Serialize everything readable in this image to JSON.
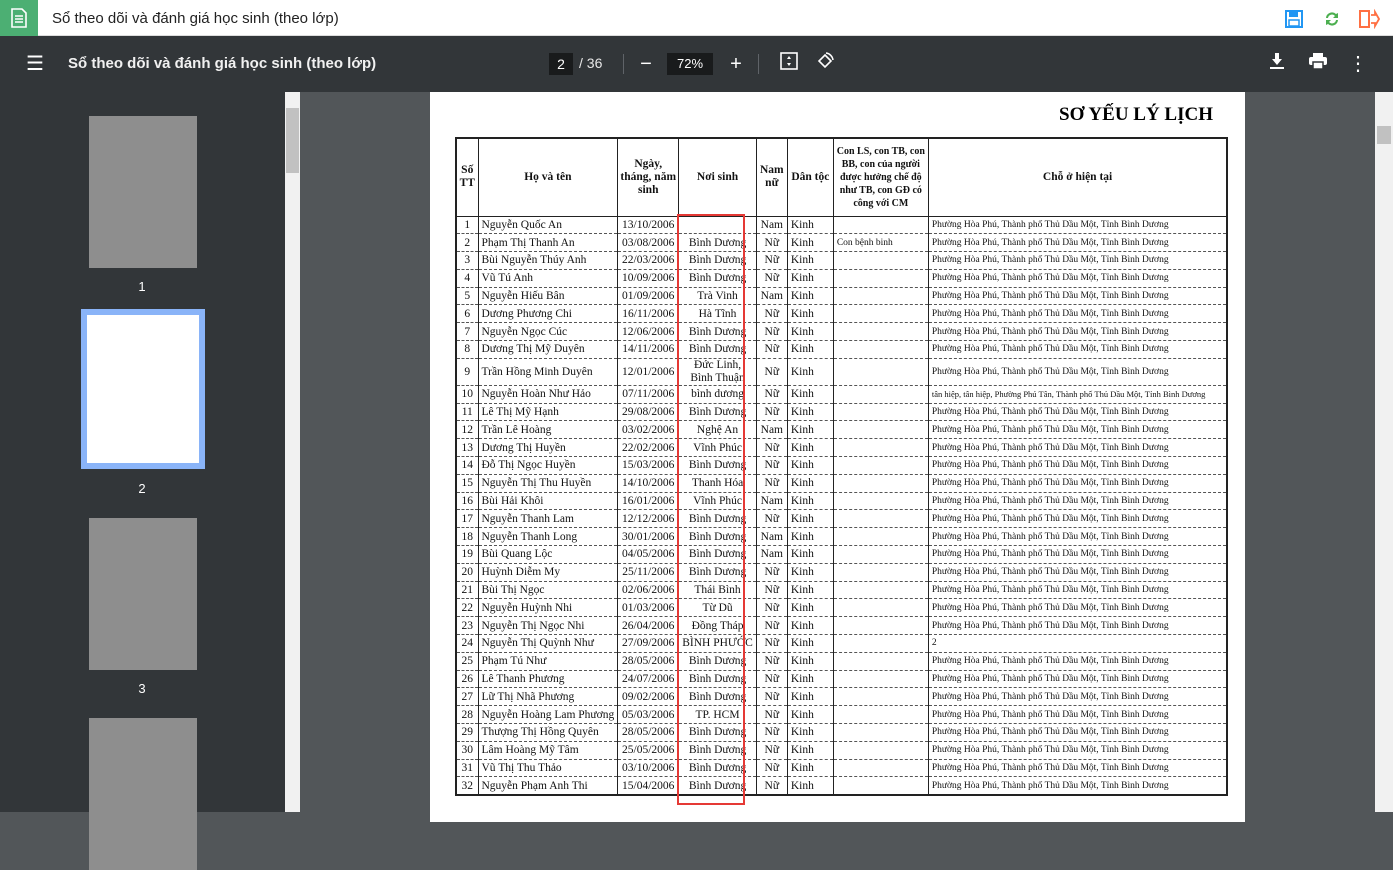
{
  "app": {
    "title": "Sổ theo dõi và đánh giá học sinh (theo lớp)",
    "colors": {
      "accent": "#4caf73",
      "save": "#2196f3",
      "sync": "#4caf50",
      "exit": "#ff7043",
      "highlight": "#e53935"
    }
  },
  "toolbar": {
    "title": "Sổ theo dõi và đánh giá học sinh (theo lớp)",
    "page": "2",
    "total": "/ 36",
    "zoom": "72%",
    "icons": [
      "menu-icon",
      "zoom-out-icon",
      "zoom-in-icon",
      "fit-page-icon",
      "rotate-icon",
      "download-icon",
      "print-icon",
      "more-icon"
    ]
  },
  "thumbs": [
    "1",
    "2",
    "3"
  ],
  "doc": {
    "title": "SƠ YẾU LÝ LỊCH",
    "headers": [
      "Số TT",
      "Họ và tên",
      "Ngày, tháng, năm sinh",
      "Nơi sinh",
      "Nam nữ",
      "Dân tộc",
      "Con LS, con TB, con BB, con của người được hưởng chế độ như TB, con GĐ có công với CM",
      "Chỗ ở hiện tại"
    ],
    "rows": [
      [
        "1",
        "Nguyễn Quốc An",
        "13/10/2006",
        "",
        "Nam",
        "Kinh",
        "",
        "Phường Hòa Phú, Thành phố Thủ Dầu Một, Tỉnh Bình Dương"
      ],
      [
        "2",
        "Phạm Thị Thanh An",
        "03/08/2006",
        "Bình Dương",
        "Nữ",
        "Kinh",
        "Con bệnh binh",
        "Phường Hòa Phú, Thành phố Thủ Dầu Một, Tỉnh Bình Dương"
      ],
      [
        "3",
        "Bùi Nguyễn Thúy Anh",
        "22/03/2006",
        "Bình Dương",
        "Nữ",
        "Kinh",
        "",
        "Phường Hòa Phú, Thành phố Thủ Dầu Một, Tỉnh Bình Dương"
      ],
      [
        "4",
        "Vũ Tú Anh",
        "10/09/2006",
        "Bình Dương",
        "Nữ",
        "Kinh",
        "",
        "Phường Hòa Phú, Thành phố Thủ Dầu Một, Tỉnh Bình Dương"
      ],
      [
        "5",
        "Nguyễn Hiếu Bân",
        "01/09/2006",
        "Trà Vinh",
        "Nam",
        "Kinh",
        "",
        "Phường Hòa Phú, Thành phố Thủ Dầu Một, Tỉnh Bình Dương"
      ],
      [
        "6",
        "Dương Phương Chi",
        "16/11/2006",
        "Hà Tĩnh",
        "Nữ",
        "Kinh",
        "",
        "Phường Hòa Phú, Thành phố Thủ Dầu Một, Tỉnh Bình Dương"
      ],
      [
        "7",
        "Nguyễn Ngọc Cúc",
        "12/06/2006",
        "Bình Dương",
        "Nữ",
        "Kinh",
        "",
        "Phường Hòa Phú, Thành phố Thủ Dầu Một, Tỉnh Bình Dương"
      ],
      [
        "8",
        "Dương Thị Mỹ Duyên",
        "14/11/2006",
        "Bình Dương",
        "Nữ",
        "Kinh",
        "",
        "Phường Hòa Phú, Thành phố Thủ Dầu Một, Tỉnh Bình Dương"
      ],
      [
        "9",
        "Trần Hồng Minh Duyên",
        "12/01/2006",
        "Đức Linh, Bình Thuận",
        "Nữ",
        "Kinh",
        "",
        "Phường Hòa Phú, Thành phố Thủ Dầu Một, Tỉnh Bình Dương"
      ],
      [
        "10",
        "Nguyễn Hoàn Như Hảo",
        "07/11/2006",
        "bình dương",
        "Nữ",
        "Kinh",
        "",
        "tân hiệp, tân hiệp, Phường Phú Tân, Thành phố Thủ Dầu Một, Tỉnh Bình Dương"
      ],
      [
        "11",
        "Lê Thị Mỹ Hạnh",
        "29/08/2006",
        "Bình Dương",
        "Nữ",
        "Kinh",
        "",
        "Phường Hòa Phú, Thành phố Thủ Dầu Một, Tỉnh Bình Dương"
      ],
      [
        "12",
        "Trần Lê Hoàng",
        "03/02/2006",
        "Nghệ An",
        "Nam",
        "Kinh",
        "",
        "Phường Hòa Phú, Thành phố Thủ Dầu Một, Tỉnh Bình Dương"
      ],
      [
        "13",
        "Dương Thị Huyền",
        "22/02/2006",
        "Vĩnh Phúc",
        "Nữ",
        "Kinh",
        "",
        "Phường Hòa Phú, Thành phố Thủ Dầu Một, Tỉnh Bình Dương"
      ],
      [
        "14",
        "Đỗ Thị Ngọc Huyền",
        "15/03/2006",
        "Bình Dương",
        "Nữ",
        "Kinh",
        "",
        "Phường Hòa Phú, Thành phố Thủ Dầu Một, Tỉnh Bình Dương"
      ],
      [
        "15",
        "Nguyễn Thị Thu Huyền",
        "14/10/2006",
        "Thanh Hóa",
        "Nữ",
        "Kinh",
        "",
        "Phường Hòa Phú, Thành phố Thủ Dầu Một, Tỉnh Bình Dương"
      ],
      [
        "16",
        "Bùi Hải Khôi",
        "16/01/2006",
        "Vĩnh Phúc",
        "Nam",
        "Kinh",
        "",
        "Phường Hòa Phú, Thành phố Thủ Dầu Một, Tỉnh Bình Dương"
      ],
      [
        "17",
        "Nguyễn Thanh Lam",
        "12/12/2006",
        "Bình Dương",
        "Nữ",
        "Kinh",
        "",
        "Phường Hòa Phú, Thành phố Thủ Dầu Một, Tỉnh Bình Dương"
      ],
      [
        "18",
        "Nguyễn Thanh Long",
        "30/01/2006",
        "Bình Dương",
        "Nam",
        "Kinh",
        "",
        "Phường Hòa Phú, Thành phố Thủ Dầu Một, Tỉnh Bình Dương"
      ],
      [
        "19",
        "Bùi Quang Lộc",
        "04/05/2006",
        "Bình Dương",
        "Nam",
        "Kinh",
        "",
        "Phường Hòa Phú, Thành phố Thủ Dầu Một, Tỉnh Bình Dương"
      ],
      [
        "20",
        "Huỳnh Diễm My",
        "25/11/2006",
        "Bình Dương",
        "Nữ",
        "Kinh",
        "",
        "Phường Hòa Phú, Thành phố Thủ Dầu Một, Tỉnh Bình Dương"
      ],
      [
        "21",
        "Bùi Thị Ngọc",
        "02/06/2006",
        "Thái Bình",
        "Nữ",
        "Kinh",
        "",
        "Phường Hòa Phú, Thành phố Thủ Dầu Một, Tỉnh Bình Dương"
      ],
      [
        "22",
        "Nguyễn Huỳnh Nhi",
        "01/03/2006",
        "Từ Dũ",
        "Nữ",
        "Kinh",
        "",
        "Phường Hòa Phú, Thành phố Thủ Dầu Một, Tỉnh Bình Dương"
      ],
      [
        "23",
        "Nguyễn Thị Ngọc Nhi",
        "26/04/2006",
        "Đồng Tháp",
        "Nữ",
        "Kinh",
        "",
        "Phường Hòa Phú, Thành phố Thủ Dầu Một, Tỉnh Bình Dương"
      ],
      [
        "24",
        "Nguyễn Thị Quỳnh Như",
        "27/09/2006",
        "BÌNH PHƯỚC",
        "Nữ",
        "Kinh",
        "",
        "2"
      ],
      [
        "25",
        "Phạm Tú Như",
        "28/05/2006",
        "Bình Dương",
        "Nữ",
        "Kinh",
        "",
        "Phường Hòa Phú, Thành phố Thủ Dầu Một, Tỉnh Bình Dương"
      ],
      [
        "26",
        "Lê Thanh Phương",
        "24/07/2006",
        "Bình Dương",
        "Nữ",
        "Kinh",
        "",
        "Phường Hòa Phú, Thành phố Thủ Dầu Một, Tỉnh Bình Dương"
      ],
      [
        "27",
        "Lữ Thị Nhã Phương",
        "09/02/2006",
        "Bình Dương",
        "Nữ",
        "Kinh",
        "",
        "Phường Hòa Phú, Thành phố Thủ Dầu Một, Tỉnh Bình Dương"
      ],
      [
        "28",
        "Nguyễn Hoàng Lam Phương",
        "05/03/2006",
        "TP. HCM",
        "Nữ",
        "Kinh",
        "",
        "Phường Hòa Phú, Thành phố Thủ Dầu Một, Tỉnh Bình Dương"
      ],
      [
        "29",
        "Thượng Thị Hồng Quyên",
        "28/05/2006",
        "Bình Dương",
        "Nữ",
        "Kinh",
        "",
        "Phường Hòa Phú, Thành phố Thủ Dầu Một, Tỉnh Bình Dương"
      ],
      [
        "30",
        "Lâm Hoàng Mỹ Tâm",
        "25/05/2006",
        "Bình Dương",
        "Nữ",
        "Kinh",
        "",
        "Phường Hòa Phú, Thành phố Thủ Dầu Một, Tỉnh Bình Dương"
      ],
      [
        "31",
        "Vũ Thị Thu Thảo",
        "03/10/2006",
        "Bình Dương",
        "Nữ",
        "Kinh",
        "",
        "Phường Hòa Phú, Thành phố Thủ Dầu Một, Tỉnh Bình Dương"
      ],
      [
        "32",
        "Nguyễn Phạm Anh Thi",
        "15/04/2006",
        "Bình Dương",
        "Nữ",
        "Kinh",
        "",
        "Phường Hòa Phú, Thành phố Thủ Dầu Một, Tỉnh Bình Dương"
      ]
    ]
  }
}
